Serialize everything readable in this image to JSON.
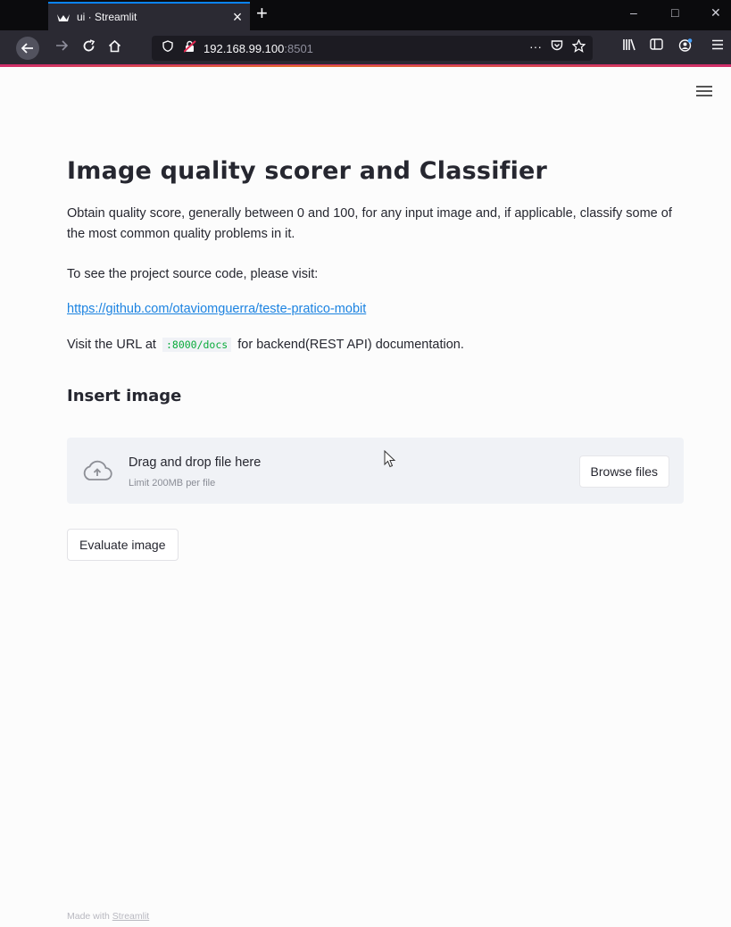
{
  "browser": {
    "tab_title": "ui · Streamlit",
    "tab_close": "×",
    "new_tab": "+",
    "url_host": "192.168.99.100",
    "url_port": ":8501",
    "page_actions": "···",
    "window_controls": {
      "minimize": "–",
      "maximize": "□",
      "close": "✕"
    }
  },
  "app": {
    "title": "Image quality scorer and Classifier",
    "intro": "Obtain quality score, generally between 0 and 100, for any input image and, if applicable, classify some of the most common quality problems in it.",
    "source_prompt": "To see the project source code, please visit:",
    "source_link": "https://github.com/otaviomguerra/teste-pratico-mobit",
    "docs_prefix": "Visit the URL at",
    "docs_path": ":8000/docs",
    "docs_suffix": "for backend(REST API) documentation.",
    "insert_heading": "Insert image",
    "uploader": {
      "drop_text": "Drag and drop file here",
      "limit_text": "Limit 200MB per file",
      "browse_label": "Browse files"
    },
    "evaluate_label": "Evaluate image"
  },
  "footer": {
    "made_with": "Made with",
    "streamlit_link": "Streamlit"
  },
  "colors": {
    "accent_link": "#1c83e1",
    "code_green": "#09ab3b",
    "uploader_bg": "#f0f2f6",
    "tab_accent": "#0a84ff"
  }
}
